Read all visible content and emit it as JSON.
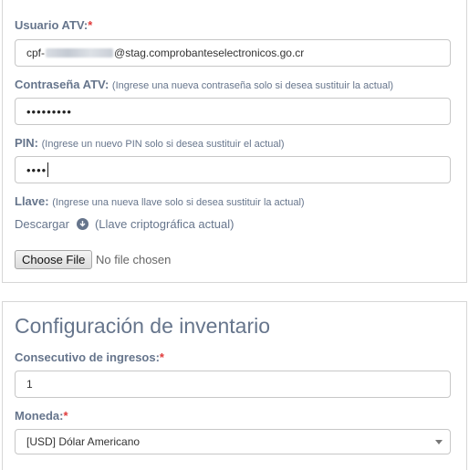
{
  "atv": {
    "usuario": {
      "label": "Usuario ATV:",
      "required_mark": "*",
      "value_prefix": "cpf-",
      "value_suffix": "@stag.comprobanteselectronicos.go.cr"
    },
    "contrasena": {
      "label": "Contraseña ATV:",
      "hint": "(Ingrese una nueva contraseña solo si desea sustituir la actual)",
      "value_masked": "•••••••••"
    },
    "pin": {
      "label": "PIN:",
      "hint": "(Ingrese un nuevo PIN solo si desea sustituir el actual)",
      "value_masked": "••••"
    },
    "llave": {
      "label": "Llave:",
      "hint": "(Ingrese una nueva llave solo si desea sustituir la actual)",
      "download_label": "Descargar",
      "download_icon": "download-circle-icon",
      "download_note": "(Llave criptográfica actual)",
      "file_button": "Choose File",
      "file_status": "No file chosen"
    }
  },
  "inventario": {
    "title": "Configuración de inventario",
    "consecutivo": {
      "label": "Consecutivo de ingresos:",
      "required_mark": "*",
      "value": "1"
    },
    "moneda": {
      "label": "Moneda:",
      "required_mark": "*",
      "selected": "[USD] Dólar Americano"
    }
  },
  "colors": {
    "label": "#66758c",
    "required": "#e03b3b",
    "border": "#c7c7c7"
  }
}
